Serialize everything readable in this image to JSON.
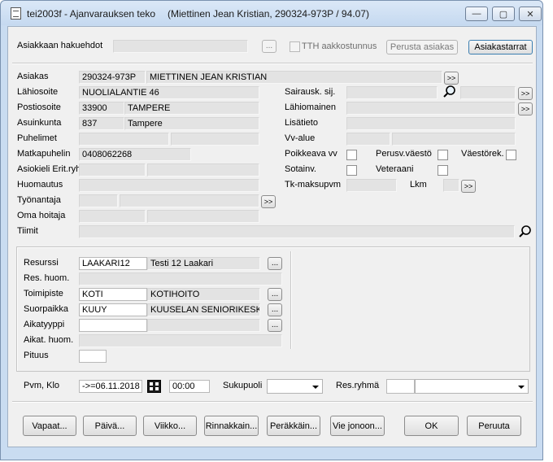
{
  "window": {
    "title": "tei2003f - Ajanvarauksen teko",
    "subtitle": "(Miettinen Jean Kristian, 290324-973P / 94.07)",
    "minimize": "—",
    "maximize": "▢",
    "close": "✕"
  },
  "search": {
    "label": "Asiakkaan hakuehdot",
    "value": "",
    "dots": "...",
    "tth_label": "TTH aakkostunnus",
    "perusta_asiakas": "Perusta asiakas",
    "asiakastarrat": "Asiakastarrat"
  },
  "customer": {
    "asiakas_label": "Asiakas",
    "asiakas_id": "290324-973P",
    "asiakas_name": "MIETTINEN JEAN KRISTIAN",
    "lahiosoite_label": "Lähiosoite",
    "lahiosoite": "NUOLIALANTIE 46",
    "postiosoite_label": "Postiosoite",
    "postinumero": "33900",
    "postitoimipaikka": "TAMPERE",
    "asuinkunta_label": "Asuinkunta",
    "kuntanumero": "837",
    "kunta": "Tampere",
    "puhelimet_label": "Puhelimet",
    "matkapuhelin_label": "Matkapuhelin",
    "matkapuhelin": "0408062268",
    "asiokieli_label": "Asiokieli Erit.ryh.",
    "huomautus_label": "Huomautus",
    "tyonantaja_label": "Työnantaja",
    "oma_hoitaja_label": "Oma hoitaja",
    "tiimit_label": "Tiimit",
    "sairausk_label": "Sairausk. sij.",
    "lahiomainen_label": "Lähiomainen",
    "lisatieto_label": "Lisätieto",
    "vv_alue_label": "Vv-alue",
    "poikkeava_vv_label": "Poikkeava vv",
    "perusv_label": "Perusv.väestö",
    "vaestorek_label": "Väestörek.",
    "sotainv_label": "Sotainv.",
    "veteraani_label": "Veteraani",
    "tk_maksupvm_label": "Tk-maksupvm",
    "lkm_label": "Lkm",
    "more": ">>"
  },
  "resource": {
    "resurssi_label": "Resurssi",
    "resurssi_code": "LAAKARI12",
    "resurssi_name": "Testi 12 Laakari",
    "res_huom_label": "Res. huom.",
    "toimipiste_label": "Toimipiste",
    "toimipiste_code": "KOTI",
    "toimipiste_name": "KOTIHOITO",
    "suorpaikka_label": "Suorpaikka",
    "suorpaikka_code": "KUUY",
    "suorpaikka_name": "KUUSELAN SENIORIKESK...",
    "aikatyyppi_label": "Aikatyyppi",
    "aikat_huom_label": "Aikat. huom.",
    "pituus_label": "Pituus",
    "dots": "..."
  },
  "datetime": {
    "pvm_label": "Pvm, Klo",
    "date": "->=06.11.2018",
    "time": "00:00",
    "sukupuoli_label": "Sukupuoli",
    "resryhma_label": "Res.ryhmä"
  },
  "buttons": {
    "vapaat": "Vapaat...",
    "paiva": "Päivä...",
    "viikko": "Viikko...",
    "rinnakkain": "Rinnakkain...",
    "perakkain": "Peräkkäin...",
    "vie_jonoon": "Vie jonoon...",
    "ok": "OK",
    "peruuta": "Peruuta"
  }
}
